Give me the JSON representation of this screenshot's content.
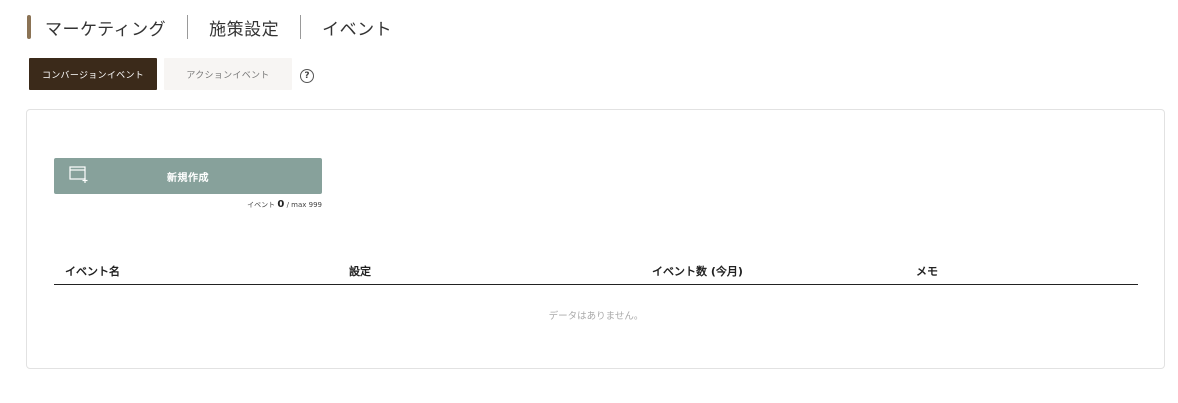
{
  "breadcrumb": {
    "items": [
      "マーケティング",
      "施策設定",
      "イベント"
    ],
    "marker_color": "#8b7355"
  },
  "tabs": {
    "active_label": "コンバージョンイベント",
    "inactive_label": "アクションイベント",
    "help": "?"
  },
  "create": {
    "label": "新規作成",
    "icon": "add-window-icon"
  },
  "count": {
    "prefix": "イベント",
    "current": "0",
    "suffix": "/ max 999"
  },
  "table": {
    "columns": [
      "イベント名",
      "設定",
      "イベント数 (今月)",
      "メモ"
    ],
    "empty_message": "データはありません。"
  }
}
